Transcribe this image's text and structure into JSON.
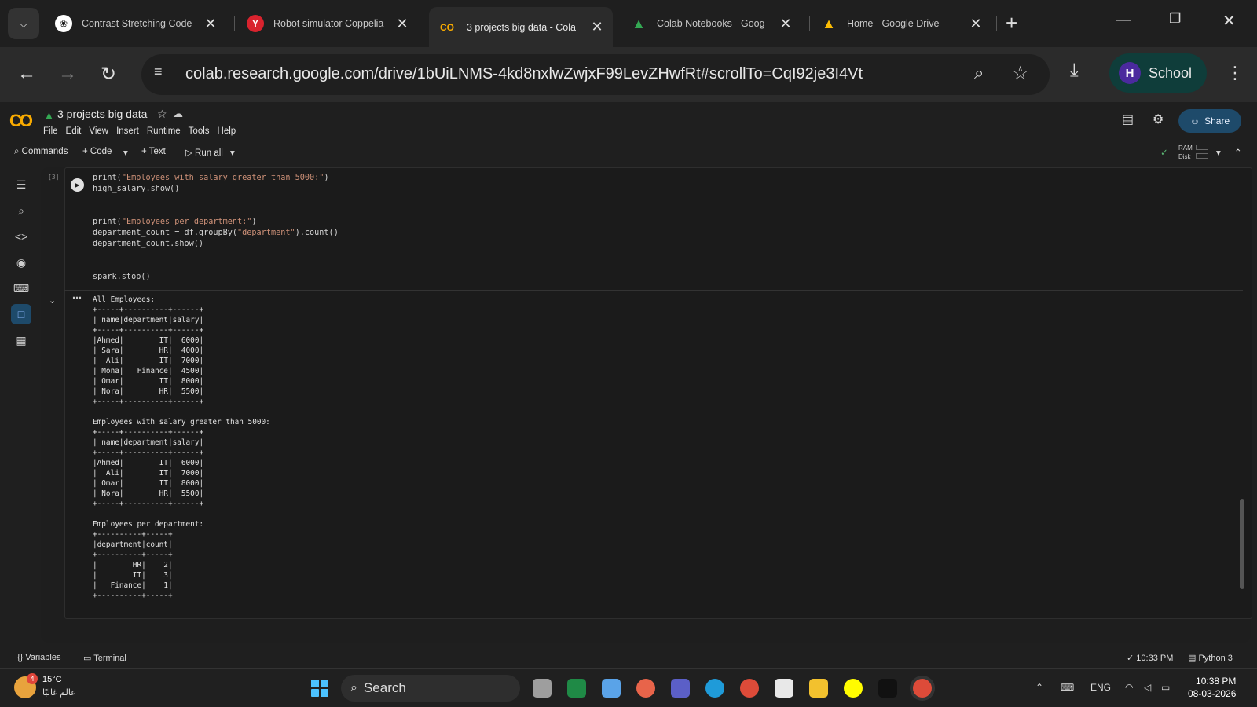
{
  "browser": {
    "tabs": [
      {
        "title": "Contrast Stretching Code",
        "favicon": "chatgpt-icon"
      },
      {
        "title": "Robot simulator Coppelia",
        "favicon": "coppelia-icon"
      },
      {
        "title": "3 projects big data - Cola",
        "favicon": "colab-icon",
        "active": true
      },
      {
        "title": "Colab Notebooks - Goog",
        "favicon": "drive-icon"
      },
      {
        "title": "Home - Google Drive",
        "favicon": "drive-icon"
      }
    ],
    "url": "colab.research.google.com/drive/1bUiLNMS-4kd8nxlwZwjxF99LevZHwfRt#scrollTo=CqI92je3I4Vt",
    "profile_initial": "H",
    "profile_name": "School"
  },
  "colab": {
    "logo": "CO",
    "notebook_title": "3 projects big data",
    "menu": [
      "File",
      "Edit",
      "View",
      "Insert",
      "Runtime",
      "Tools",
      "Help"
    ],
    "share_label": "Share",
    "toolbar": {
      "commands": "Commands",
      "code": "+ Code",
      "text": "+ Text",
      "run_all": "Run all",
      "ram": "RAM",
      "disk": "Disk"
    },
    "cell": {
      "execution_count": "[3]",
      "code_lines": [
        "print(\"Employees with salary greater than 5000:\")",
        "high_salary.show()",
        "",
        "",
        "print(\"Employees per department:\")",
        "department_count = df.groupBy(\"department\").count()",
        "department_count.show()",
        "",
        "",
        "spark.stop()"
      ],
      "output": "All Employees:\n+-----+----------+------+\n| name|department|salary|\n+-----+----------+------+\n|Ahmed|        IT|  6000|\n| Sara|        HR|  4000|\n|  Ali|        IT|  7000|\n| Mona|   Finance|  4500|\n| Omar|        IT|  8000|\n| Nora|        HR|  5500|\n+-----+----------+------+\n\nEmployees with salary greater than 5000:\n+-----+----------+------+\n| name|department|salary|\n+-----+----------+------+\n|Ahmed|        IT|  6000|\n|  Ali|        IT|  7000|\n| Omar|        IT|  8000|\n| Nora|        HR|  5500|\n+-----+----------+------+\n\nEmployees per department:\n+----------+-----+\n|department|count|\n+----------+-----+\n|        HR|    2|\n|        IT|    3|\n|   Finance|    1|\n+----------+-----+"
    },
    "statusbar": {
      "variables": "Variables",
      "terminal": "Terminal",
      "last_run": "10:33 PM",
      "runtime": "Python 3"
    }
  },
  "taskbar": {
    "weather_badge": "4",
    "temperature": "15°C",
    "weather_text": "عالم غالبًا",
    "search_label": "Search",
    "language": "ENG",
    "time": "10:38 PM",
    "date": "08-03-2026"
  }
}
